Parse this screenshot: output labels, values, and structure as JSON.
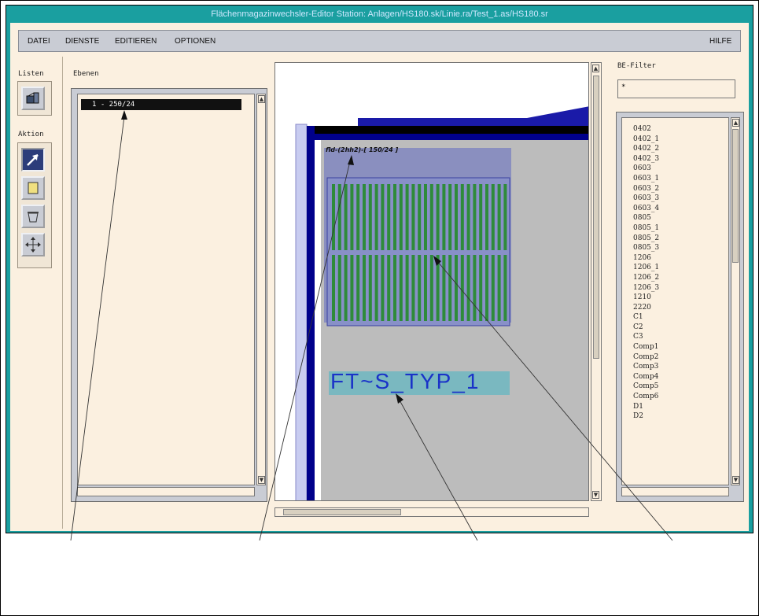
{
  "window": {
    "title": "Flächenmagazinwechsler-Editor     Station:  Anlagen/HS180.sk/Linie.ra/Test_1.as/HS180.sr"
  },
  "menu": {
    "items": [
      "DATEI",
      "DIENSTE",
      "EDITIEREN",
      "OPTIONEN"
    ],
    "help": "HILFE"
  },
  "left_toolbar": {
    "listen_label": "Listen",
    "aktion_label": "Aktion"
  },
  "ebenen": {
    "label": "Ebenen",
    "items": [
      "1 - 250/24 "
    ]
  },
  "canvas": {
    "magazine_label": "fld-(2hh2)-[ 150/24 ]",
    "type_label": "FT~S_TYP_1"
  },
  "bt_filter": {
    "label": "BE-Filter",
    "value": "*",
    "items": [
      "0402",
      "0402_1",
      "0402_2",
      "0402_3",
      "0603",
      "0603_1",
      "0603_2",
      "0603_3",
      "0603_4",
      "0805",
      "0805_1",
      "0805_2",
      "0805_3",
      "1206",
      "1206_1",
      "1206_2",
      "1206_3",
      "1210",
      "2220",
      "C1",
      "C2",
      "C3",
      "Comp1",
      "Comp2",
      "Comp3",
      "Comp4",
      "Comp5",
      "Comp6",
      "D1",
      "D2"
    ]
  },
  "colors": {
    "title_bar": "#1a9fa0",
    "client_bg": "#fbf0e0",
    "magazine_blue": "#00008b",
    "slot_green": "#2e8b3a",
    "type_label_bg": "#7ab8c0"
  }
}
